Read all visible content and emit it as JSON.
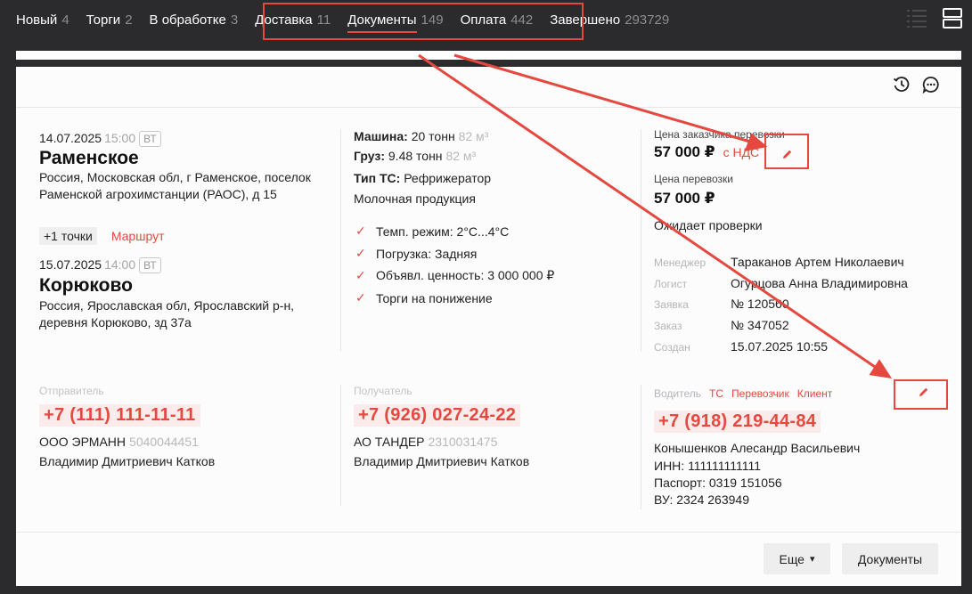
{
  "nav": {
    "tabs": [
      {
        "label": "Новый",
        "count": "4"
      },
      {
        "label": "Торги",
        "count": "2"
      },
      {
        "label": "В обработке",
        "count": "3"
      },
      {
        "label": "Доставка",
        "count": "11"
      },
      {
        "label": "Документы",
        "count": "149",
        "active": true
      },
      {
        "label": "Оплата",
        "count": "442"
      },
      {
        "label": "Завершено",
        "count": "293729"
      }
    ]
  },
  "route": {
    "origin": {
      "date": "14.07.2025",
      "time": "15:00",
      "tz": "ВТ",
      "city": "Раменское",
      "address": "Россия, Московская обл, г Раменское, поселок Раменской агрохимстанции (РАОС), д 15"
    },
    "extra_points": "+1 точки",
    "route_link": "Маршрут",
    "destination": {
      "date": "15.07.2025",
      "time": "14:00",
      "tz": "ВТ",
      "city": "Корюково",
      "address": "Россия, Ярославская обл, Ярославский р-н, деревня Корюково, зд 37а"
    }
  },
  "cargo": {
    "machine_label": "Машина:",
    "machine_value": "20 тонн",
    "machine_volume": "82 м³",
    "cargo_label": "Груз:",
    "cargo_value": "9.48 тонн",
    "cargo_volume": "82 м³",
    "vehicle_type_label": "Тип ТС:",
    "vehicle_type_value": "Рефрижератор",
    "goods": "Молочная продукция",
    "checks": [
      "Темп. режим: 2°C...4°C",
      "Погрузка: Задняя",
      "Объявл. ценность: 3 000 000 ₽",
      "Торги на понижение"
    ]
  },
  "pricing": {
    "customer_price_label": "Цена заказчика перевозки",
    "customer_price": "57 000 ₽",
    "vat": "с НДС",
    "carrier_price_label": "Цена перевозки",
    "carrier_price": "57 000 ₽",
    "status": "Ожидает проверки",
    "meta": [
      {
        "label": "Менеджер",
        "value": "Тараканов Артем Николаевич"
      },
      {
        "label": "Логист",
        "value": "Огурцова Анна Владимировна"
      },
      {
        "label": "Заявка",
        "value": "№ 120560"
      },
      {
        "label": "Заказ",
        "value": "№ 347052"
      },
      {
        "label": "Создан",
        "value": "15.07.2025 10:55"
      }
    ]
  },
  "sender": {
    "label": "Отправитель",
    "phone": "+7 (111) 111-11-11",
    "company": "ООО ЭРМАНН",
    "inn": "5040044451",
    "contact": "Владимир Дмитриевич Катков"
  },
  "recipient": {
    "label": "Получатель",
    "phone": "+7 (926) 027-24-22",
    "company": "АО ТАНДЕР",
    "inn": "2310031475",
    "contact": "Владимир Дмитриевич Катков"
  },
  "driver": {
    "label": "Водитель",
    "links": [
      "ТС",
      "Перевозчик",
      "Клиент"
    ],
    "phone": "+7 (918) 219-44-84",
    "name": "Конышенков Алесандр Васильевич",
    "inn": "ИНН: 111111111111",
    "passport": "Паспорт: 0319 151056",
    "license": "ВУ: 2324 263949"
  },
  "footer": {
    "more_label": "Еще",
    "documents_label": "Документы"
  },
  "icons": {
    "nav_list": "list-view-icon",
    "nav_card": "card-view-icon",
    "history": "history-icon",
    "chat": "chat-icon",
    "edit": "pencil-icon"
  },
  "colors": {
    "accent": "#e5483f",
    "background": "#2b2b2d",
    "card": "#fcfcfc"
  }
}
